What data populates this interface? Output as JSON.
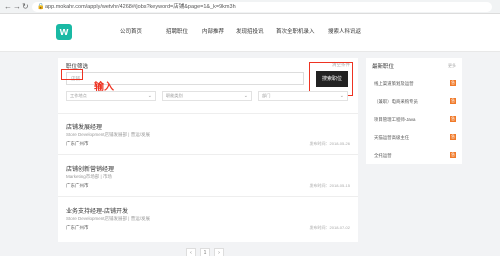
{
  "browser": {
    "url": "app.mokahr.com/apply/wetvhr/4268#/jobs?keyword=店铺&page=1&_k=9km3h"
  },
  "nav": [
    "公司首页",
    "招聘职位",
    "内部推荐",
    "发现招投讯",
    "首次全职机录入",
    "搜索人科讯返"
  ],
  "filter": {
    "title": "职位筛选",
    "clear": "清空条件",
    "placeholder": "店铺",
    "annotation": "输入",
    "search_button": "搜索职位",
    "selects": [
      "工作地点",
      "职能类别",
      "部门"
    ]
  },
  "jobs": [
    {
      "title": "店铺发展经理",
      "dept": "Store Development店铺发展部",
      "type": "营运/发展",
      "loc": "广东广州市",
      "date": "发布时间：2018-05-26"
    },
    {
      "title": "店铺创新营销经理",
      "dept": "Marketing市场部",
      "type": "市场",
      "loc": "广东广州市",
      "date": "发布时间：2018-05-15"
    },
    {
      "title": "业务支持经理-店铺开发",
      "dept": "Store Development店铺发展部",
      "type": "营运/发展",
      "loc": "广东广州市",
      "date": "发布时间：2018-07-02"
    }
  ],
  "sidebar": {
    "title": "最新职位",
    "more": "更多",
    "items": [
      "线上渠道策划及运营",
      "（兼职）电商采购专员",
      "项目管理工程师-Java",
      "天猫运营高级主任",
      "全托运营"
    ],
    "badge": "急"
  },
  "pager": [
    "‹",
    "1",
    "›"
  ]
}
